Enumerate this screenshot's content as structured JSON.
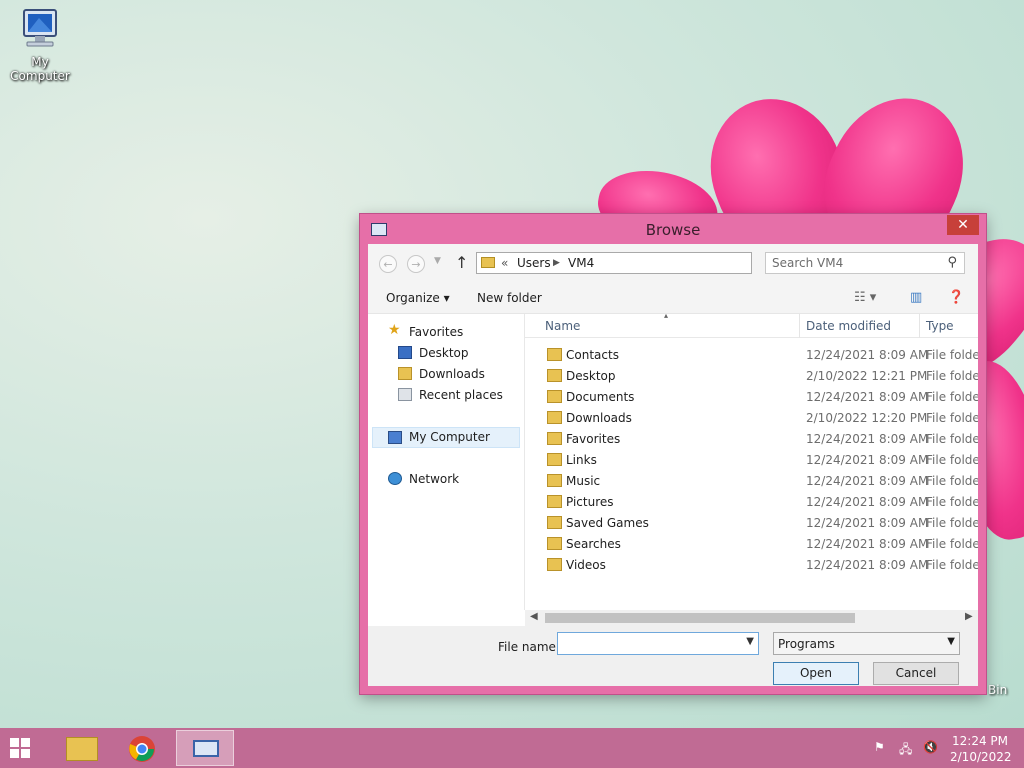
{
  "desktop": {
    "icon_label": "My Computer",
    "bin_label": "Bin"
  },
  "dialog": {
    "title": "Browse",
    "close_label": "✕",
    "address": {
      "chevron": "«",
      "crumbs": [
        "Users",
        "VM4"
      ]
    },
    "search_placeholder": "Search VM4",
    "toolbar": {
      "organize": "Organize ▾",
      "new_folder": "New folder"
    },
    "nav": {
      "favorites": "Favorites",
      "desktop": "Desktop",
      "downloads": "Downloads",
      "recent": "Recent places",
      "computer": "My Computer",
      "network": "Network"
    },
    "columns": {
      "name": "Name",
      "date": "Date modified",
      "type": "Type"
    },
    "files": [
      {
        "name": "Contacts",
        "date": "12/24/2021 8:09 AM",
        "type": "File folder"
      },
      {
        "name": "Desktop",
        "date": "2/10/2022 12:21 PM",
        "type": "File folder"
      },
      {
        "name": "Documents",
        "date": "12/24/2021 8:09 AM",
        "type": "File folder"
      },
      {
        "name": "Downloads",
        "date": "2/10/2022 12:20 PM",
        "type": "File folder"
      },
      {
        "name": "Favorites",
        "date": "12/24/2021 8:09 AM",
        "type": "File folder"
      },
      {
        "name": "Links",
        "date": "12/24/2021 8:09 AM",
        "type": "File folder"
      },
      {
        "name": "Music",
        "date": "12/24/2021 8:09 AM",
        "type": "File folder"
      },
      {
        "name": "Pictures",
        "date": "12/24/2021 8:09 AM",
        "type": "File folder"
      },
      {
        "name": "Saved Games",
        "date": "12/24/2021 8:09 AM",
        "type": "File folder"
      },
      {
        "name": "Searches",
        "date": "12/24/2021 8:09 AM",
        "type": "File folder"
      },
      {
        "name": "Videos",
        "date": "12/24/2021 8:09 AM",
        "type": "File folder"
      }
    ],
    "filename_label": "File name:",
    "filename_value": "",
    "filetype_value": "Programs",
    "open_label": "Open",
    "cancel_label": "Cancel"
  },
  "taskbar": {
    "time": "12:24 PM",
    "date": "2/10/2022"
  }
}
